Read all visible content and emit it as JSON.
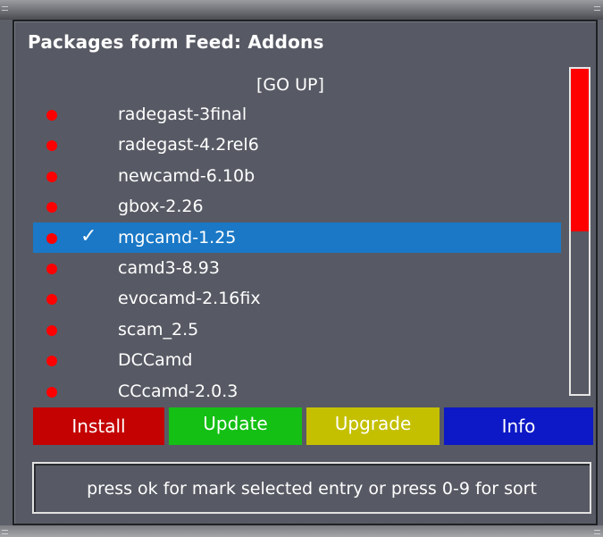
{
  "window": {
    "title": "Packages form Feed: Addons"
  },
  "list": {
    "go_up_label": "[GO UP]",
    "items": [
      {
        "label": "radegast-3final",
        "marked": false
      },
      {
        "label": "radegast-4.2rel6",
        "marked": false
      },
      {
        "label": "newcamd-6.10b",
        "marked": false
      },
      {
        "label": "gbox-2.26",
        "marked": false
      },
      {
        "label": "mgcamd-1.25",
        "marked": true,
        "selected": true
      },
      {
        "label": "camd3-8.93",
        "marked": false
      },
      {
        "label": "evocamd-2.16fix",
        "marked": false
      },
      {
        "label": "scam_2.5",
        "marked": false
      },
      {
        "label": "DCCamd",
        "marked": false
      },
      {
        "label": "CCcamd-2.0.3",
        "marked": false
      }
    ],
    "check_glyph": "✓",
    "status_dot_color": "#ff0000",
    "selection_color": "#1a78c6"
  },
  "scrollbar": {
    "thumb_fraction": 0.5,
    "thumb_color": "#ff0000"
  },
  "buttons": {
    "install": "Install",
    "update": "Update",
    "upgrade": "Upgrade",
    "info": "Info",
    "colors": {
      "install": "#c40202",
      "update": "#14c014",
      "upgrade": "#c4c000",
      "info": "#0d18c6"
    }
  },
  "status": {
    "text": "press ok for mark selected entry or press 0-9 for sort"
  }
}
